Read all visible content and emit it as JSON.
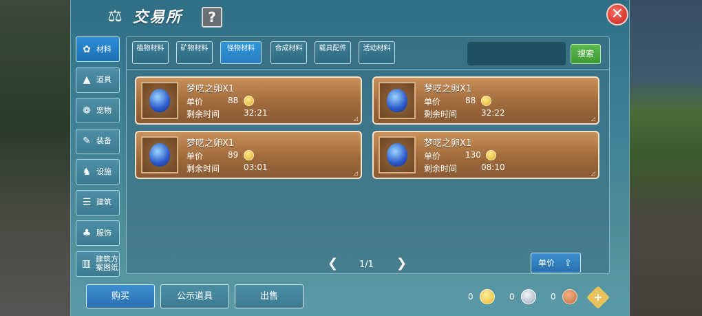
{
  "header": {
    "title": "交易所",
    "help_label": "?",
    "close_label": "✕"
  },
  "side_tabs": [
    {
      "label": "材料",
      "icon": "materials-icon",
      "active": true
    },
    {
      "label": "道具",
      "icon": "item-icon",
      "active": false
    },
    {
      "label": "宠物",
      "icon": "pet-icon",
      "active": false
    },
    {
      "label": "装备",
      "icon": "equipment-icon",
      "active": false
    },
    {
      "label": "设施",
      "icon": "facility-icon",
      "active": false
    },
    {
      "label": "建筑",
      "icon": "building-icon",
      "active": false
    },
    {
      "label": "服饰",
      "icon": "clothing-icon",
      "active": false
    },
    {
      "label": "建筑方案图纸",
      "icon": "blueprint-icon",
      "active": false
    }
  ],
  "top_tabs": [
    {
      "label": "植物材料",
      "active": false
    },
    {
      "label": "矿物材料",
      "active": false
    },
    {
      "label": "怪物材料",
      "active": true
    },
    {
      "label": "合成材料",
      "active": false
    },
    {
      "label": "载具配件",
      "active": false
    },
    {
      "label": "活动材料",
      "active": false
    }
  ],
  "search": {
    "value": "",
    "button_label": "搜索"
  },
  "price_label": "单价",
  "time_label": "剩余时间",
  "listings": [
    {
      "name": "梦呓之卵X1",
      "price": "88",
      "time": "32:21"
    },
    {
      "name": "梦呓之卵X1",
      "price": "88",
      "time": "32:22"
    },
    {
      "name": "梦呓之卵X1",
      "price": "89",
      "time": "03:01"
    },
    {
      "name": "梦呓之卵X1",
      "price": "130",
      "time": "08:10"
    }
  ],
  "pagination": {
    "text": "1/1",
    "prev": "❮",
    "next": "❯"
  },
  "sort_button": {
    "label": "单价"
  },
  "bottom": {
    "buy_label": "购买",
    "public_label": "公示道具",
    "sell_label": "出售"
  },
  "currencies": [
    {
      "amount": "0",
      "icon": "gold-coin-icon",
      "color": "#e8b42c"
    },
    {
      "amount": "0",
      "icon": "silver-coin-icon",
      "color": "#9aa6b2"
    },
    {
      "amount": "0",
      "icon": "copper-coin-icon",
      "color": "#c0703c"
    }
  ]
}
